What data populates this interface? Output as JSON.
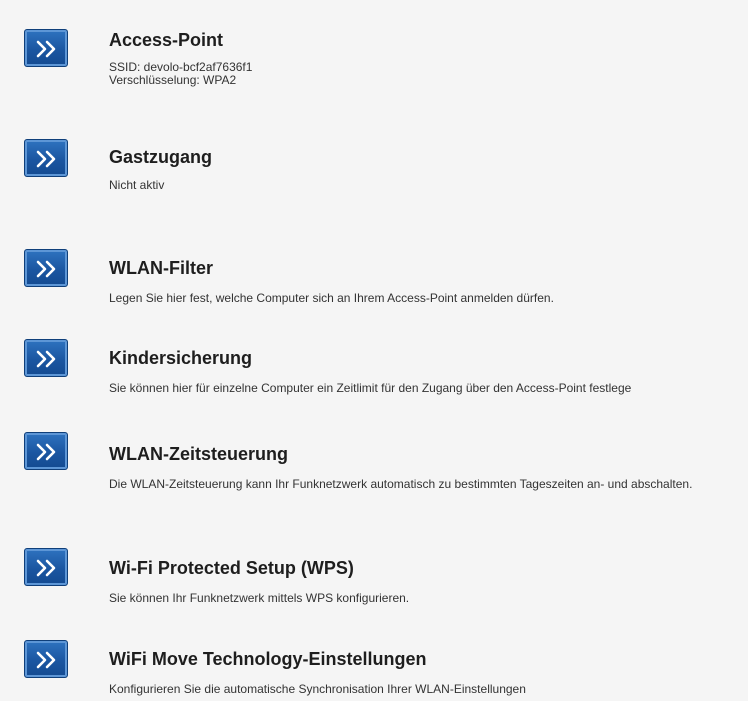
{
  "items": [
    {
      "title": "Access-Point",
      "lines": [
        "SSID: devolo-bcf2af7636f1",
        "Verschlüsselung: WPA2"
      ]
    },
    {
      "title": "Gastzugang",
      "lines": [
        "Nicht aktiv"
      ]
    },
    {
      "title": "WLAN-Filter",
      "lines": [
        "Legen Sie hier fest, welche Computer sich an Ihrem Access-Point anmelden dürfen."
      ]
    },
    {
      "title": "Kindersicherung",
      "lines": [
        "Sie können hier für einzelne Computer ein Zeitlimit für den Zugang über den Access-Point festlege"
      ]
    },
    {
      "title": "WLAN-Zeitsteuerung",
      "lines": [
        "Die WLAN-Zeitsteuerung kann Ihr Funknetzwerk automatisch zu bestimmten Tageszeiten an- und abschalten."
      ]
    },
    {
      "title": "Wi-Fi Protected Setup (WPS)",
      "lines": [
        "Sie können Ihr Funknetzwerk mittels WPS konfigurieren."
      ]
    },
    {
      "title": "WiFi Move Technology-Einstellungen",
      "lines": [
        "Konfigurieren Sie die automatische Synchronisation Ihrer WLAN-Einstellungen"
      ]
    }
  ],
  "colors": {
    "button": "#1b56a1",
    "button_border": "#0f3f7a",
    "background": "#f5f5f5"
  },
  "icons": {
    "button": "double-chevron-right-icon"
  }
}
